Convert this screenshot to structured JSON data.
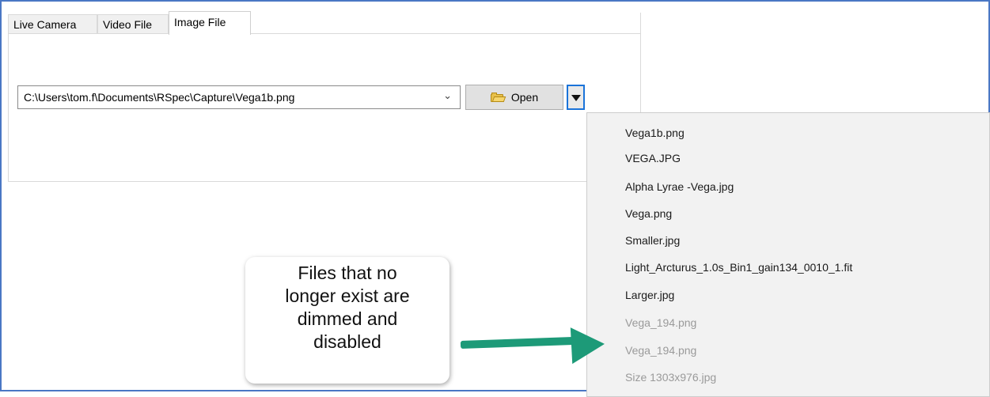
{
  "tabs": [
    {
      "label": "Live Camera",
      "active": false
    },
    {
      "label": "Video File",
      "active": false
    },
    {
      "label": "Image File",
      "active": true
    }
  ],
  "image_file": {
    "path_value": "C:\\Users\\tom.f\\Documents\\RSpec\\Capture\\Vega1b.png",
    "open_label": "Open"
  },
  "recent_menu": {
    "items": [
      {
        "label": "Vega1b.png",
        "enabled": true
      },
      {
        "label": "VEGA.JPG",
        "enabled": true
      },
      {
        "label": "Alpha Lyrae -Vega.jpg",
        "enabled": true
      },
      {
        "label": "Vega.png",
        "enabled": true
      },
      {
        "label": "Smaller.jpg",
        "enabled": true
      },
      {
        "label": "Light_Arcturus_1.0s_Bin1_gain134_0010_1.fit",
        "enabled": true
      },
      {
        "label": "Larger.jpg",
        "enabled": true
      },
      {
        "label": "Vega_194.png",
        "enabled": false
      },
      {
        "label": "Vega_194.png",
        "enabled": false
      },
      {
        "label": "Size 1303x976.jpg",
        "enabled": false
      }
    ]
  },
  "annotation": {
    "lines": [
      "Files that no",
      "longer exist are",
      "dimmed and",
      "disabled"
    ]
  },
  "colors": {
    "frame_border": "#4a77c4",
    "focus_border": "#1a73d9",
    "arrow": "#1d9a78",
    "disabled_text": "#9a9a9a"
  }
}
